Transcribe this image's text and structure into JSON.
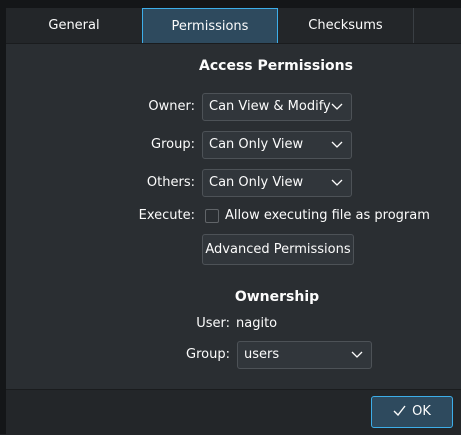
{
  "tabs": [
    {
      "label": "General"
    },
    {
      "label": "Permissions"
    },
    {
      "label": "Checksums"
    }
  ],
  "access": {
    "heading": "Access Permissions",
    "owner_label": "Owner:",
    "owner_value": "Can View & Modify",
    "group_label": "Group:",
    "group_value": "Can Only View",
    "others_label": "Others:",
    "others_value": "Can Only View",
    "execute_label": "Execute:",
    "execute_checkbox_label": "Allow executing file as program",
    "execute_checked": false,
    "advanced_button": "Advanced Permissions"
  },
  "ownership": {
    "heading": "Ownership",
    "user_label": "User:",
    "user_value": "nagito",
    "group_label": "Group:",
    "group_value": "users"
  },
  "footer": {
    "ok_label": "OK",
    "ok_icon": "checkmark-icon"
  },
  "colors": {
    "accent": "#3daee9",
    "background": "#2a2e32",
    "text": "#fcfcfc"
  }
}
